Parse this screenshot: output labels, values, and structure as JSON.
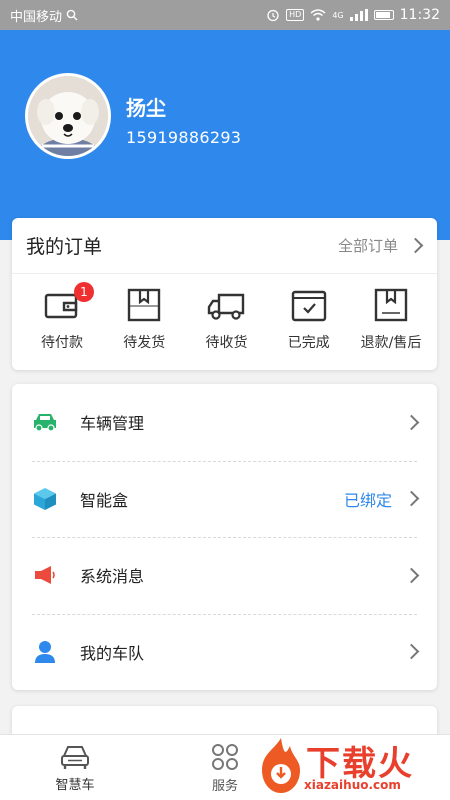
{
  "status_bar": {
    "carrier": "中国移动",
    "hd_label": "HD",
    "network": "4G",
    "time": "11:32"
  },
  "profile": {
    "name": "扬尘",
    "phone": "15919886293"
  },
  "orders": {
    "title": "我的订单",
    "view_all": "全部订单",
    "items": [
      {
        "label": "待付款",
        "icon": "wallet-icon",
        "badge": "1"
      },
      {
        "label": "待发货",
        "icon": "package-icon"
      },
      {
        "label": "待收货",
        "icon": "truck-icon"
      },
      {
        "label": "已完成",
        "icon": "check-box-icon"
      },
      {
        "label": "退款/售后",
        "icon": "package-return-icon"
      }
    ]
  },
  "menu": {
    "items": [
      {
        "label": "车辆管理",
        "icon": "car-icon",
        "icon_color": "#27b36b"
      },
      {
        "label": "智能盒",
        "icon": "cube-icon",
        "value": "已绑定",
        "icon_color": "#2aa7d8"
      },
      {
        "label": "系统消息",
        "icon": "megaphone-icon",
        "icon_color": "#ec4a3d"
      },
      {
        "label": "我的车队",
        "icon": "person-icon",
        "icon_color": "#2f88ec"
      }
    ]
  },
  "tabs": [
    {
      "label": "智慧车",
      "icon": "car-outline-icon"
    },
    {
      "label": "服务",
      "icon": "grid-petal-icon"
    }
  ],
  "watermark": {
    "text": "下载火",
    "url": "xiazaihuo.com"
  },
  "colors": {
    "header_blue": "#2f88ec",
    "badge_red": "#f03030",
    "link_blue": "#2f88ec"
  }
}
